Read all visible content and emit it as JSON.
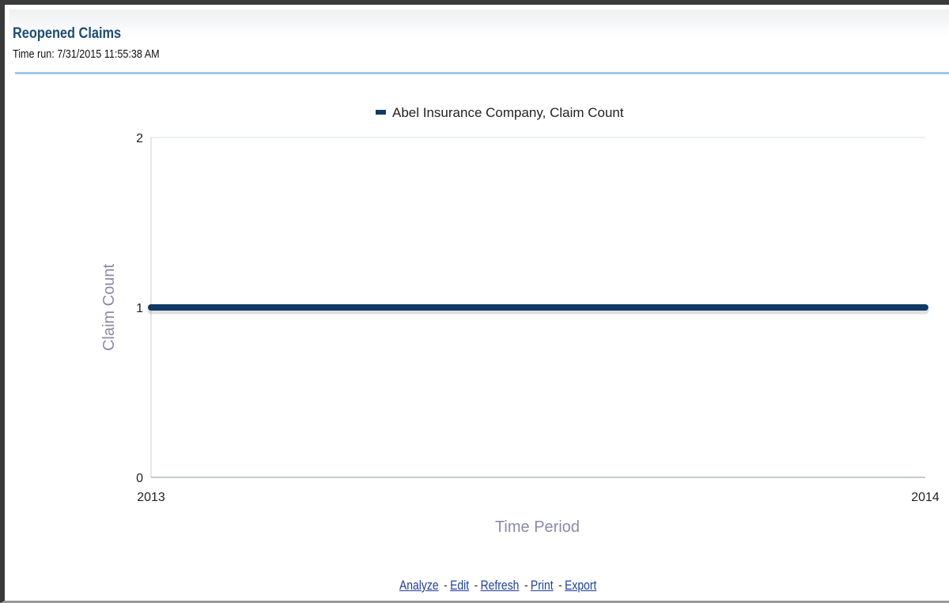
{
  "report": {
    "title": "Reopened Claims",
    "time_run": "Time run: 7/31/2015 11:55:38 AM"
  },
  "links": {
    "analyze": "Analyze",
    "edit": "Edit",
    "refresh": "Refresh",
    "print": "Print",
    "export": "Export",
    "separator": "-"
  },
  "colors": {
    "series": "#0f3a66",
    "title": "#1d4d74",
    "axis_title": "#8a8aa8",
    "link": "#1f3f9a"
  },
  "chart_data": {
    "type": "line",
    "title": "",
    "xlabel": "Time Period",
    "ylabel": "Claim Count",
    "x": [
      "2013",
      "2014"
    ],
    "series": [
      {
        "name": "Abel Insurance Company, Claim Count",
        "values": [
          1,
          1
        ]
      }
    ],
    "ylim": [
      0,
      2
    ],
    "yticks": [
      0,
      1,
      2
    ],
    "grid": true,
    "legend": "top-center"
  }
}
